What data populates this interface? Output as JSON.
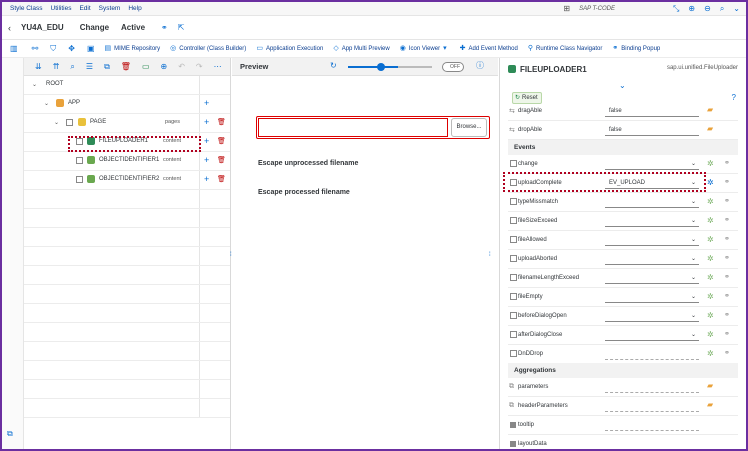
{
  "menu": {
    "items": [
      "Style Class",
      "Utilities",
      "Edit",
      "System",
      "Help"
    ],
    "tcode_label": "SAP T-CODE"
  },
  "titlebar": {
    "app": "YU4A_EDU",
    "mode": "Change",
    "status": "Active"
  },
  "toolbar": {
    "items": [
      {
        "label": "MIME Repository"
      },
      {
        "label": "Controller (Class Builder)"
      },
      {
        "label": "Application Execution"
      },
      {
        "label": "App Multi Preview"
      },
      {
        "label": "Icon Viewer"
      },
      {
        "label": "Add Event Method"
      },
      {
        "label": "Runtime Class Navigator"
      },
      {
        "label": "Binding Popup"
      }
    ]
  },
  "tree": {
    "rows": [
      {
        "label": "ROOT",
        "sub": ""
      },
      {
        "label": "APP",
        "sub": ""
      },
      {
        "label": "PAGE",
        "sub": "pages"
      },
      {
        "label": "FILEUPLOADER1",
        "sub": "content"
      },
      {
        "label": "OBJECTIDENTIFIER1",
        "sub": "content"
      },
      {
        "label": "OBJECTIDENTIFIER2",
        "sub": "content"
      }
    ]
  },
  "preview": {
    "title": "Preview",
    "toggle": "OFF",
    "browse_label": "Browse...",
    "text1": "Escape unprocessed filename",
    "text2": "Escape processed filename"
  },
  "props": {
    "control": "FILEUPLOADER1",
    "class": "sap.ui.unified.FileUploader",
    "reset_label": "Reset",
    "top_rows": [
      {
        "name": "dragAble",
        "value": "false"
      },
      {
        "name": "dropAble",
        "value": "false"
      }
    ],
    "events_header": "Events",
    "events": [
      {
        "name": "change",
        "value": ""
      },
      {
        "name": "uploadComplete",
        "value": "EV_UPLOAD"
      },
      {
        "name": "typeMissmatch",
        "value": ""
      },
      {
        "name": "fileSizeExceed",
        "value": ""
      },
      {
        "name": "fileAllowed",
        "value": ""
      },
      {
        "name": "uploadAborted",
        "value": ""
      },
      {
        "name": "filenameLengthExceed",
        "value": ""
      },
      {
        "name": "fileEmpty",
        "value": ""
      },
      {
        "name": "beforeDialogOpen",
        "value": ""
      },
      {
        "name": "afterDialogClose",
        "value": ""
      },
      {
        "name": "DnDDrop",
        "value": ""
      }
    ],
    "aggregations_header": "Aggregations",
    "aggregations": [
      {
        "name": "parameters"
      },
      {
        "name": "headerParameters"
      },
      {
        "name": "tooltip"
      },
      {
        "name": "layoutData"
      }
    ]
  },
  "colors": {
    "accent": "#0a6ed1",
    "highlight": "#b0001f",
    "frame": "#6b2fa0"
  }
}
